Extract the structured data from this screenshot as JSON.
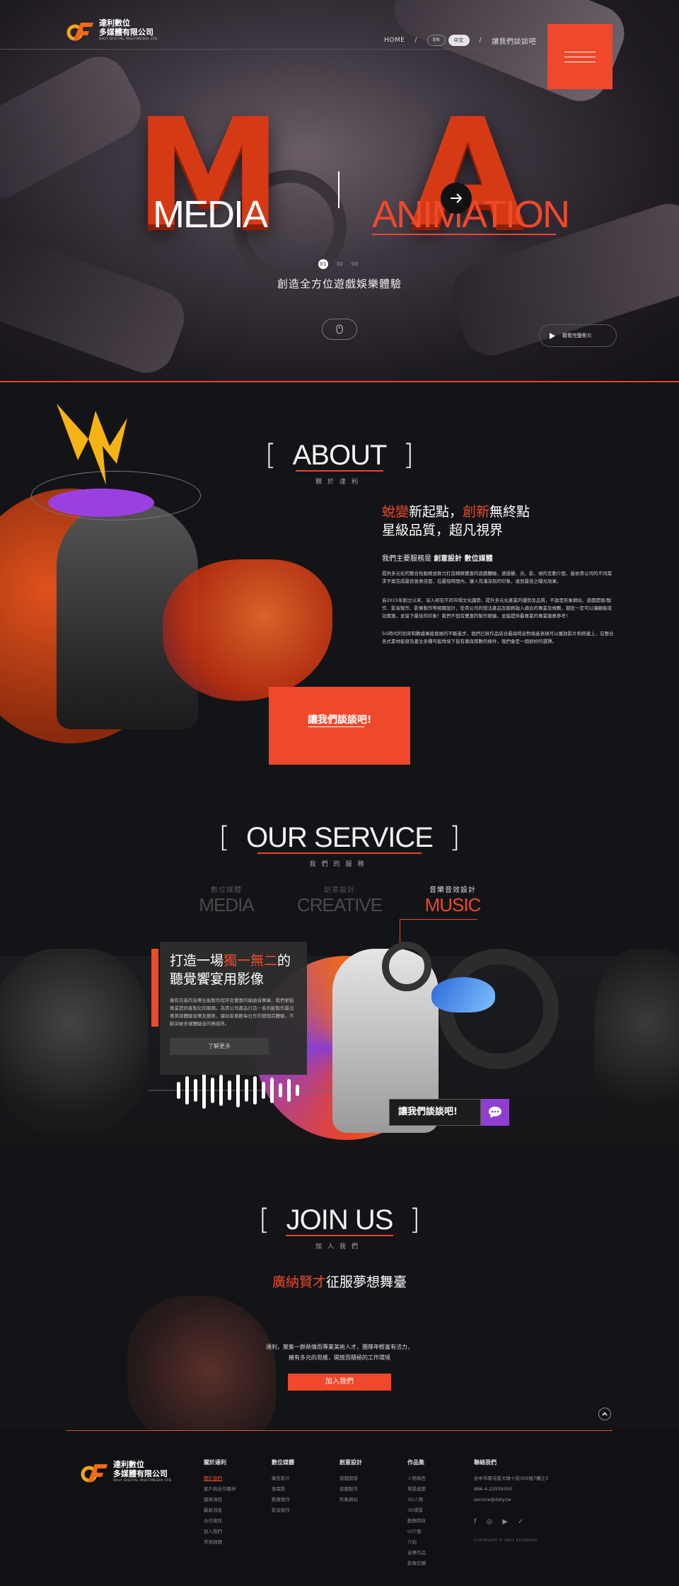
{
  "brand": {
    "name_line1": "達利數位",
    "name_line2": "多媒體有限公司",
    "name_en": "DALY DIGITAL MULTIMEDIA LTD."
  },
  "nav": {
    "home": "HOME",
    "sep": "/",
    "lang_en": "EN",
    "lang_zh": "中文",
    "contact": "讓我們談談吧"
  },
  "hero": {
    "letter_left": "M",
    "letter_right": "A",
    "word_left": "MEDIA",
    "word_right": "ANIMATION",
    "slogan": "創造全方位遊戲娛樂體驗",
    "slides": [
      "01",
      "02",
      "03"
    ],
    "video_link": "觀看完整影片",
    "play_icon": "play-icon"
  },
  "about": {
    "title": "ABOUT",
    "subtitle": "關於達利",
    "head_red1": "蛻變",
    "head_mid1": "新起點，",
    "head_red2": "創新",
    "head_mid2": "無終點",
    "head_line2": "星級品質，超凡視界",
    "services_prefix": "我們主要服務是",
    "services_bold": "創意設計 數位媒體",
    "p1": "提供多元化的整合性服務並致力打造精緻豐富的遊戲體驗，透過聲、光、影、視的互動介面，能依貴公司的不同需求予案完成最良善意佳面，在最短時間內，讓人充滿深刻的印象，達到最佳之曝光效果。",
    "p2": "自2015年創立以來，深入研究不同市場文化趨勢，提升多元化產業的優勢及品質，不論是形象網站、遊戲開發/製作、影音製作、影像製作等相關設計，從貴公司的想法產品及服務融入適合的專業及規劃，都從一定可以讓顧客成功實施，並留下最佳的印象！我們不但有豐富的製作經驗，並能提供最專業的專業服務參考！",
    "p3": "5G時代的到來和數據萬能發展的不斷進步，我們已將作品結合最與時足對俱進表現可以播放影片和搭建上，在整合各式素材能發及產生各種可能情境下皆有著與眾數的條件，我們會是一個很好的選擇。",
    "cta": "讓我們談談吧!"
  },
  "service": {
    "title": "OUR SERVICE",
    "subtitle": "我們的服務",
    "cats": [
      {
        "sub": "數位媒體",
        "name": "MEDIA"
      },
      {
        "sub": "創意設計",
        "name": "CREATIVE"
      },
      {
        "sub": "音樂音效設計",
        "name": "MUSIC"
      }
    ],
    "card_title_pre": "打造一場",
    "card_title_red": "獨一無二",
    "card_title_post": "的",
    "card_title_line2": "聽覺饗宴用影像",
    "card_p": "擁有完善的音樂全能製作程序及豐富的編曲音樂庫，我們更能專業提供客製化的服務。為貴公司產品打造一系列能製作最出專美感體驗音樂及藝術，讓玩家喜歡每位作的個個完體驗，不斷突破多樣體驗音的無感界。",
    "more": "了解更多",
    "chat": "讓我們談談吧!"
  },
  "join": {
    "title": "JOIN US",
    "subtitle": "加入我們",
    "head_red": "廣納賢才",
    "head_rest": "征服夢想舞臺",
    "p_line1": "達利，聚集一群熱情而專業美術人才，團隊年輕富有活力，",
    "p_line2": "擁有多元的思維，開放而積極的工作環境",
    "btn": "加入我們"
  },
  "footer": {
    "cols": [
      {
        "title": "關於達利",
        "items": [
          "關於我們",
          "客戶與合作夥伴",
          "服務項目",
          "最新消息",
          "合作資訊",
          "加入我們",
          "常見問題"
        ]
      },
      {
        "title": "數位媒體",
        "items": [
          "廣告影片",
          "微電影",
          "動畫製作",
          "影音製作"
        ]
      },
      {
        "title": "創意設計",
        "items": [
          "遊戲開發",
          "遊戲製作",
          "形象網站"
        ]
      },
      {
        "title": "作品集",
        "items": [
          "人物角色",
          "場景建築",
          "3D人物",
          "3D場景",
          "動態特效",
          "UI介面",
          "介紹",
          "音樂作品",
          "影像剪輯"
        ]
      }
    ],
    "contact_title": "聯絡我們",
    "address": "台中市南屯區大墩十街300號7樓之3",
    "phone": "886-4-22559350",
    "email": "service@daly.tw",
    "social": [
      "f",
      "◎",
      "▶",
      "✓"
    ],
    "copyright": "COPYRIGHT © DALY RESERVED"
  }
}
